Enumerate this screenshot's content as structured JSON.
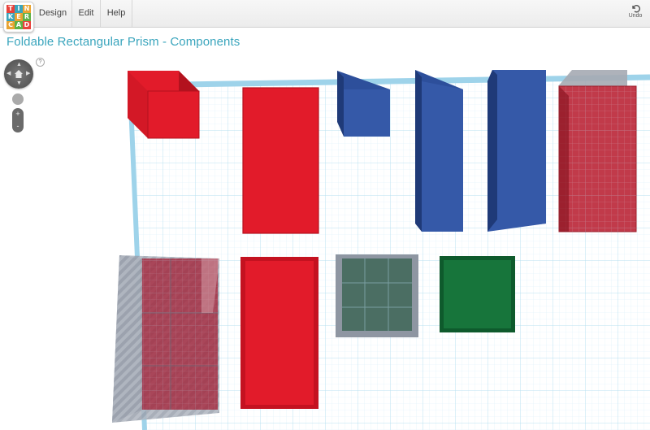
{
  "app": {
    "logo_letters": [
      "T",
      "I",
      "N",
      "K",
      "E",
      "R",
      "C",
      "A",
      "D"
    ],
    "logo_colors": [
      "#e8423b",
      "#3aa5bd",
      "#e8a331",
      "#3aa5bd",
      "#e8a331",
      "#5fb146",
      "#e8a331",
      "#5fb146",
      "#e8423b"
    ]
  },
  "menu": {
    "items": [
      {
        "label": "Design"
      },
      {
        "label": "Edit"
      },
      {
        "label": "Help"
      }
    ]
  },
  "toolbar": {
    "undo_label": "Undo"
  },
  "project": {
    "title": "Foldable Rectangular Prism - Components"
  },
  "view": {
    "help_label": "?",
    "zoom_in": "+",
    "zoom_out": "-"
  },
  "colors": {
    "red": "#e21b2a",
    "blue": "#2d4f9b",
    "green": "#17753b",
    "hole": "#8e96a2",
    "grid": "#c5e6f4",
    "accent": "#3aa5bd"
  },
  "scene": {
    "objects": [
      {
        "name": "red-cube",
        "kind": "solid",
        "color": "red"
      },
      {
        "name": "red-tall-box",
        "kind": "solid",
        "color": "red"
      },
      {
        "name": "blue-small-wedge",
        "kind": "solid",
        "color": "blue"
      },
      {
        "name": "blue-panel-middle",
        "kind": "solid",
        "color": "blue"
      },
      {
        "name": "blue-panel-right",
        "kind": "solid",
        "color": "blue"
      },
      {
        "name": "red-box-with-hole",
        "kind": "group",
        "color": "red"
      },
      {
        "name": "large-hole-group",
        "kind": "hole",
        "color": "red"
      },
      {
        "name": "red-flat-box",
        "kind": "solid",
        "color": "red"
      },
      {
        "name": "hole-square",
        "kind": "hole",
        "color": "green"
      },
      {
        "name": "green-square",
        "kind": "solid",
        "color": "green"
      }
    ]
  }
}
